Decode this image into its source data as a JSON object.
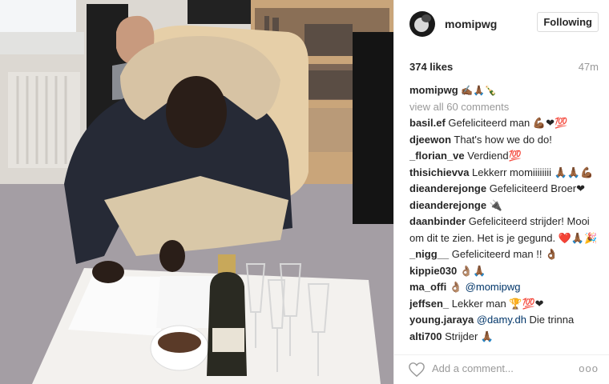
{
  "post": {
    "username": "momipwg",
    "follow_label": "Following",
    "likes": "374 likes",
    "time": "47m"
  },
  "comments": {
    "view_all": "view all 60 comments",
    "caption": {
      "user": "momipwg",
      "text": " ✍🏾🙏🏾🍾"
    },
    "items": [
      {
        "user": "basil.ef",
        "text": " Gefeliciteerd man 💪🏾❤💯"
      },
      {
        "user": "djeewon",
        "text": " That's how we do do!"
      },
      {
        "user": "_florian_ve",
        "text": " Verdiend💯"
      },
      {
        "user": "thisichievva",
        "text": " Lekkerr momiiiiiiii 🙏🏾🙏🏾💪🏾"
      },
      {
        "user": "dieanderejonge",
        "text": " Gefeliciteerd Broer❤"
      },
      {
        "user": "dieanderejonge",
        "text": " 🔌"
      },
      {
        "user": "daanbinder",
        "text": " Gefeliciteerd strijder! Mooi om dit te zien. Het is je gegund. ❤️🙏🏾🎉"
      },
      {
        "user": "_nigg__",
        "text": " Gefeliciteerd man !! 👌🏾"
      },
      {
        "user": "kippie030",
        "text": " 👌🏽🙏🏾"
      },
      {
        "user": "ma_offi",
        "text": " 👌🏽",
        "mention": "@momipwg"
      },
      {
        "user": "jeffsen_",
        "text": " Lekker man 🏆💯❤"
      },
      {
        "user": "young.jaraya",
        "mention_first": "@damy.dh",
        "text": " Die trinna"
      },
      {
        "user": "alti700",
        "text": " Strijder 🙏🏾"
      }
    ]
  },
  "footer": {
    "placeholder": "Add a comment...",
    "more": "ooo"
  },
  "icons": {
    "like": "heart-icon",
    "more": "more-options-icon"
  },
  "colors": {
    "link": "#003569",
    "muted": "#999999",
    "border": "#dbdbdb"
  }
}
